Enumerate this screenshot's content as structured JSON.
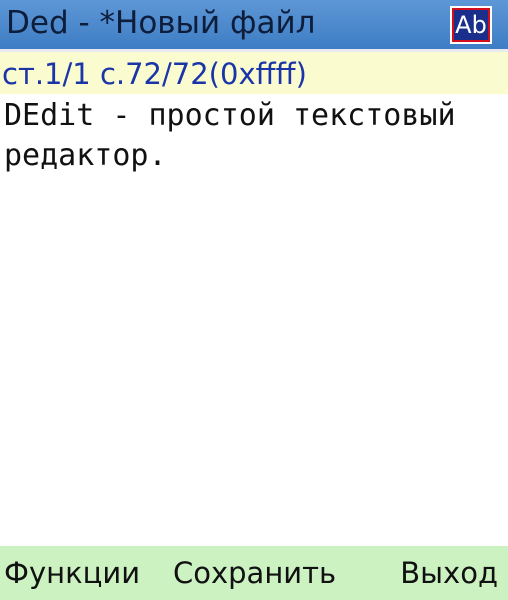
{
  "window": {
    "title": "Ded - *Новый файл",
    "input_mode": "Ab"
  },
  "status": {
    "text": "ст.1/1 с.72/72(0xffff)"
  },
  "editor": {
    "content": "DEdit - простой текстовый\nредактор."
  },
  "softkeys": {
    "left": "Функции",
    "center": "Сохранить",
    "right": "Выход"
  },
  "colors": {
    "titlebar": "#4a88cc",
    "statusbar": "#fbfbd0",
    "status_text": "#1a35a8",
    "softkeys": "#ccf2c2",
    "input_mode_border": "#d10e1c",
    "input_mode_bg": "#1a2f8c"
  }
}
